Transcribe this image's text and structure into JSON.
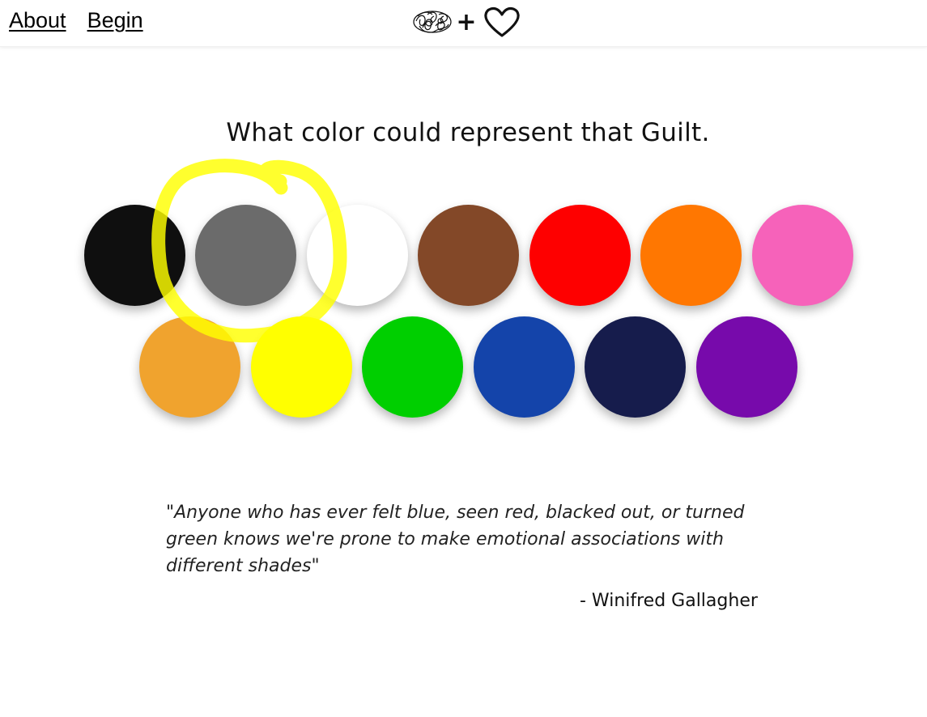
{
  "nav": {
    "about_label": "About",
    "begin_label": "Begin"
  },
  "logo": {
    "plus": "+",
    "icons": [
      "brain-icon",
      "heart-icon"
    ]
  },
  "prompt": "What color could represent that Guilt.",
  "swatches": [
    {
      "name": "black",
      "color": "#0f0f0f"
    },
    {
      "name": "gray",
      "color": "#6b6b6b"
    },
    {
      "name": "white",
      "color": "#ffffff"
    },
    {
      "name": "brown",
      "color": "#834828"
    },
    {
      "name": "red",
      "color": "#fe0000"
    },
    {
      "name": "orange",
      "color": "#ff7701"
    },
    {
      "name": "pink",
      "color": "#f662ba"
    },
    {
      "name": "light-orange",
      "color": "#f0a32e"
    },
    {
      "name": "yellow",
      "color": "#ffff00"
    },
    {
      "name": "green",
      "color": "#00cf00"
    },
    {
      "name": "blue",
      "color": "#1444aa"
    },
    {
      "name": "navy",
      "color": "#161c4c"
    },
    {
      "name": "purple",
      "color": "#770aab"
    }
  ],
  "highlighted_swatch": "gray",
  "highlight_color": "#ffff00",
  "quote": {
    "text": "\"Anyone who has ever felt blue, seen red, blacked out, or turned green knows we're prone to make emotional associations with different shades\"",
    "author": "- Winifred Gallagher"
  }
}
